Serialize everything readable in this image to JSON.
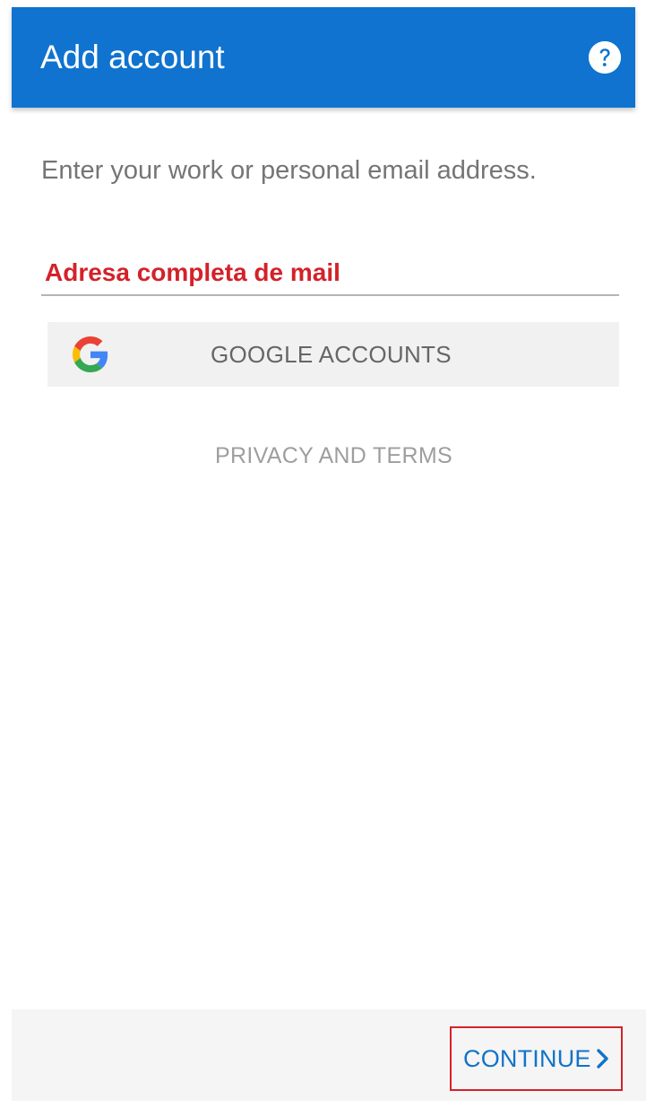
{
  "header": {
    "title": "Add account",
    "help_icon": "help-circle-icon",
    "background_color": "#0f73cf"
  },
  "main": {
    "instruction": "Enter your work or personal email address.",
    "email_field": {
      "value": "",
      "placeholder": "Adresa completa de mail",
      "placeholder_color": "#d3222a"
    },
    "google_button": {
      "label": "GOOGLE ACCOUNTS",
      "icon": "google-logo-icon"
    },
    "privacy_link": "PRIVACY AND TERMS"
  },
  "footer": {
    "continue_label": "CONTINUE",
    "continue_icon": "chevron-right-icon",
    "accent_color": "#1273c8",
    "highlight_color": "#d3222a"
  }
}
